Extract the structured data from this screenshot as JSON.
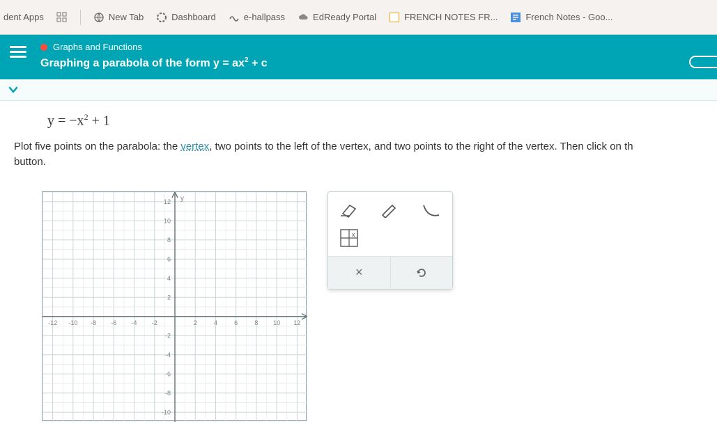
{
  "bookmarks": {
    "apps_label": "dent Apps",
    "apps_icon": "apps-grid-icon",
    "items": [
      {
        "label": "New Tab",
        "icon": "globe"
      },
      {
        "label": "Dashboard",
        "icon": "ring"
      },
      {
        "label": "e-hallpass",
        "icon": "wave"
      },
      {
        "label": "EdReady Portal",
        "icon": "cloud"
      },
      {
        "label": "FRENCH NOTES FR...",
        "icon": "doc-orange"
      },
      {
        "label": "French Notes - Goo...",
        "icon": "doc-blue"
      }
    ]
  },
  "header": {
    "breadcrumb": "Graphs and Functions",
    "title_prefix": "Graphing a parabola of the form y = ax",
    "title_exp": "2",
    "title_suffix": " + c"
  },
  "problem": {
    "eq_lhs": "y = −x",
    "eq_exp": "2",
    "eq_rhs": " + 1",
    "instr_1": "Plot five points on the parabola: the ",
    "vertex_word": "vertex",
    "instr_2": ", two points to the left of the vertex, and two points to the right of the vertex. Then click on th",
    "instr_3": "button."
  },
  "graph": {
    "x_ticks": [
      "-12",
      "-10",
      "-8",
      "-6",
      "-4",
      "-2",
      "2",
      "4",
      "6",
      "8",
      "10",
      "12"
    ],
    "y_ticks": [
      "12",
      "10",
      "8",
      "6",
      "4",
      "2",
      "-2",
      "-4",
      "-6",
      "-8",
      "-10"
    ],
    "xmin": -13,
    "xmax": 13,
    "ymin": -11,
    "ymax": 13
  },
  "toolbox": {
    "tools": [
      "eraser",
      "pencil",
      "curve",
      "grid-zoom"
    ],
    "actions": {
      "clear": "×",
      "undo": "↺"
    }
  }
}
